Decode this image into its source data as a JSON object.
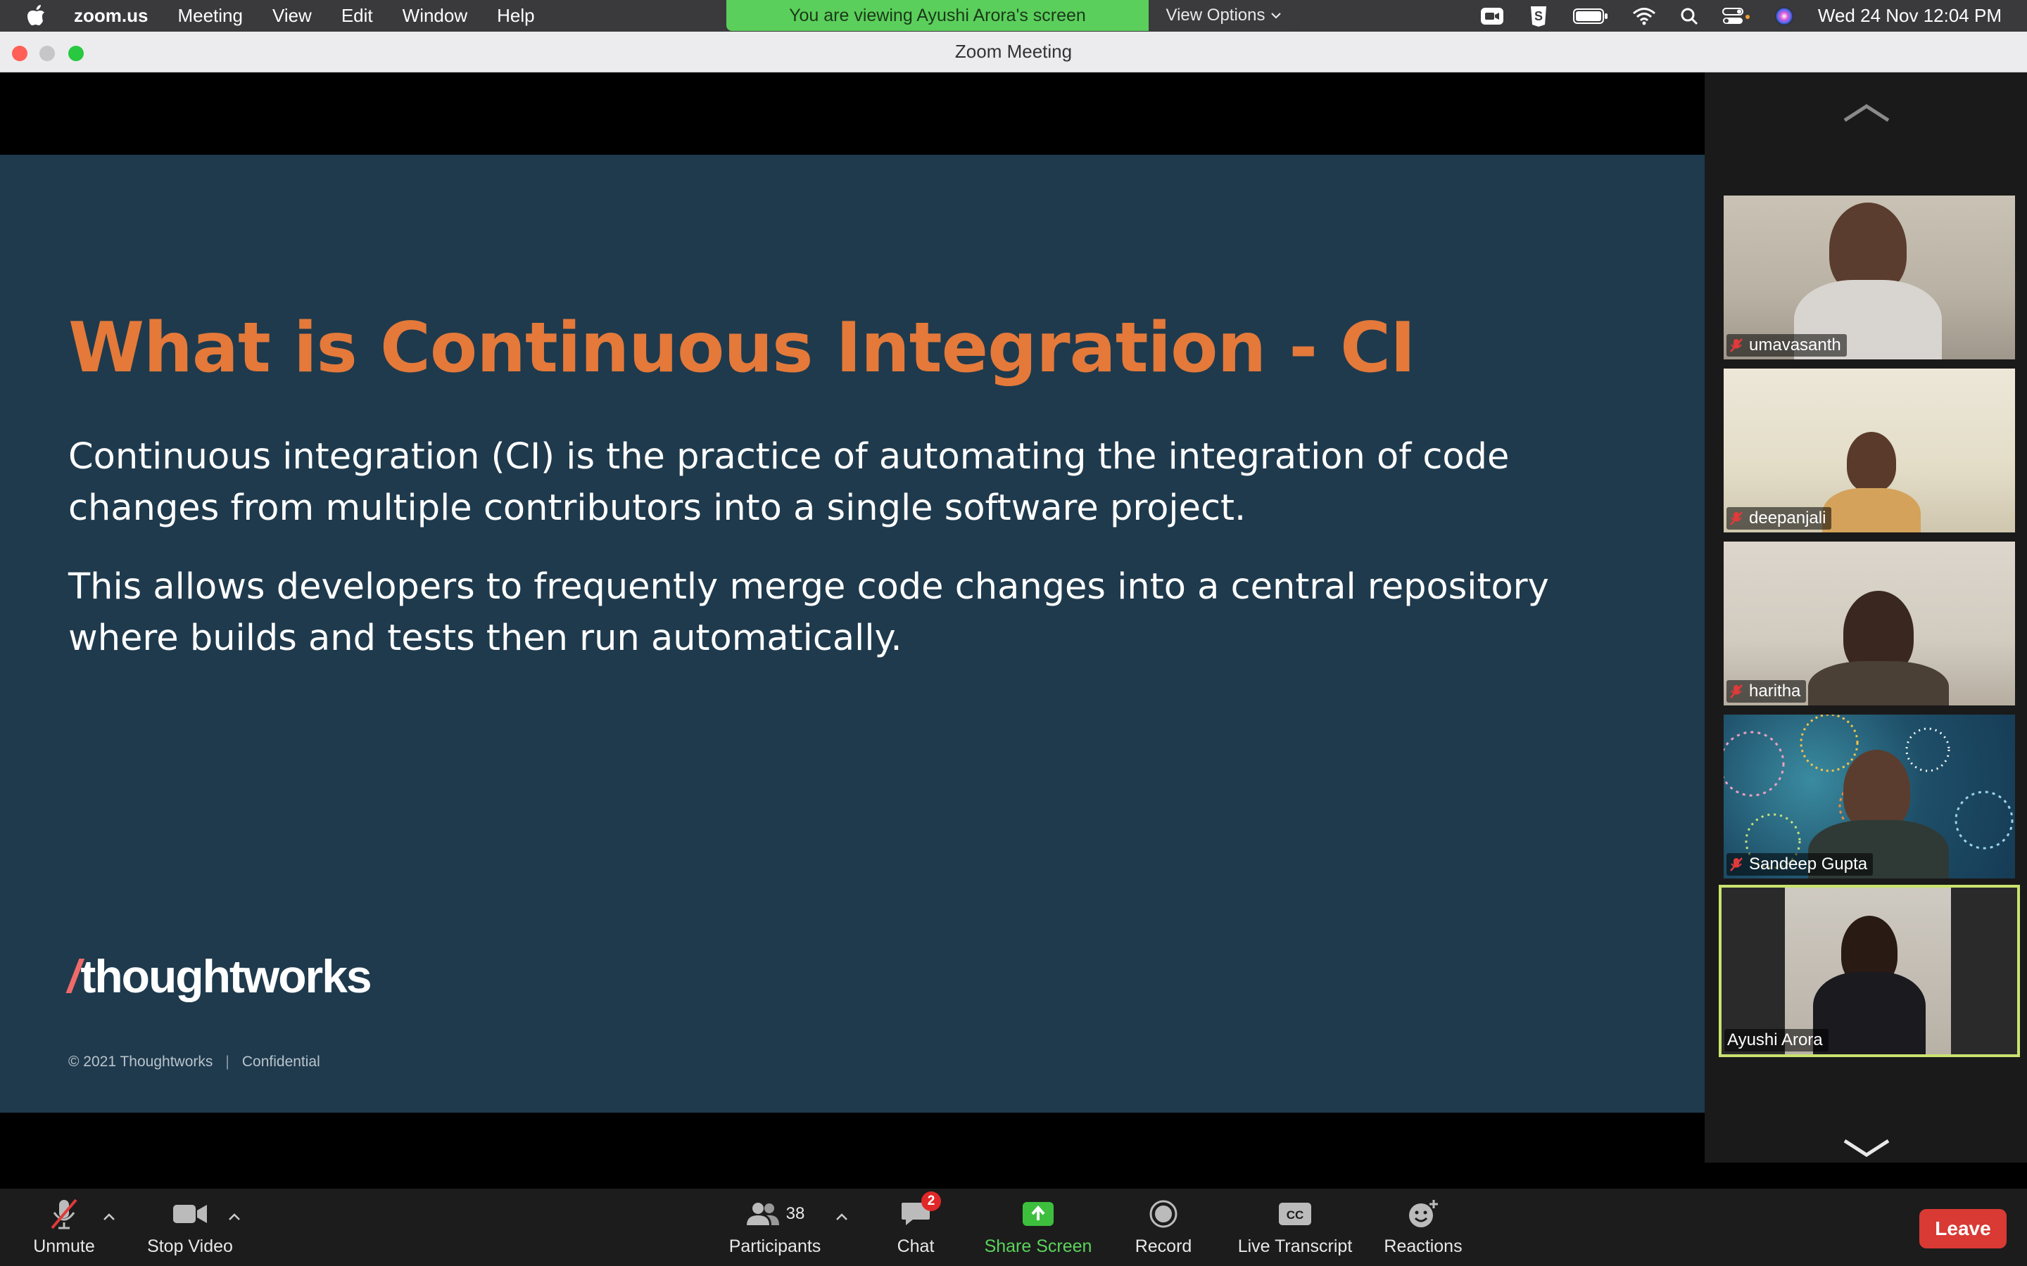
{
  "menubar": {
    "app_name": "zoom.us",
    "menus": [
      "Meeting",
      "View",
      "Edit",
      "Window",
      "Help"
    ],
    "clock": "Wed 24 Nov  12:04 PM"
  },
  "share_banner": {
    "text": "You are viewing Ayushi Arora's screen",
    "view_options": "View Options"
  },
  "window": {
    "title": "Zoom Meeting"
  },
  "slide": {
    "title": "What is Continuous Integration - CI",
    "paragraph1": "Continuous integration (CI) is the practice of automating the integration of code changes from multiple contributors into a single software project.",
    "paragraph2": "This allows developers to frequently merge code changes into a central repository where builds and tests then run automatically.",
    "logo_slash": "/",
    "logo_text": "thoughtworks",
    "footer_copyright": "© 2021 Thoughtworks",
    "footer_sep": "|",
    "footer_confidential": "Confidential"
  },
  "participants": [
    {
      "name": "umavasanth",
      "muted": true
    },
    {
      "name": "deepanjali",
      "muted": true
    },
    {
      "name": "haritha",
      "muted": true
    },
    {
      "name": "Sandeep Gupta",
      "muted": true
    },
    {
      "name": "Ayushi Arora",
      "muted": false,
      "active_speaker": true
    }
  ],
  "toolbar": {
    "unmute": "Unmute",
    "stop_video": "Stop Video",
    "participants": "Participants",
    "participants_count": "38",
    "chat": "Chat",
    "chat_badge": "2",
    "share_screen": "Share Screen",
    "record": "Record",
    "live_transcript": "Live Transcript",
    "reactions": "Reactions",
    "leave": "Leave"
  },
  "colors": {
    "slide_bg": "#1f3a4d",
    "title_orange": "#e4793a",
    "banner_green": "#5bcf5b",
    "leave_red": "#d93a34",
    "active_border": "#c9e36f"
  }
}
